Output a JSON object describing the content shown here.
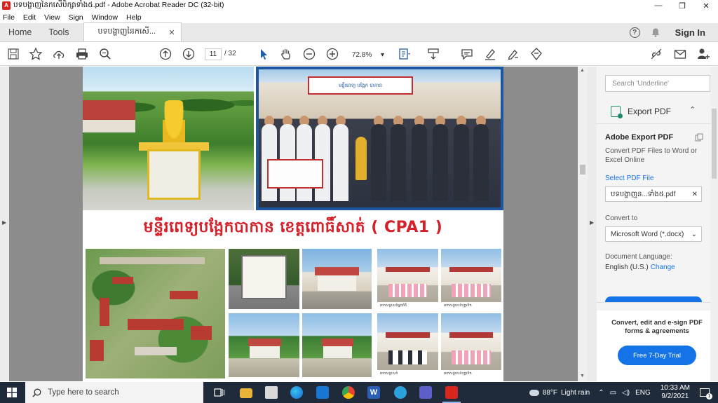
{
  "window": {
    "title": "បទបង្ហាញនៃកសើបិក្សាទាំង៥.pdf - Adobe Acrobat Reader DC (32-bit)",
    "minimize_glyph": "—",
    "maximize_glyph": "❐",
    "close_glyph": "✕"
  },
  "menu": [
    "File",
    "Edit",
    "View",
    "Sign",
    "Window",
    "Help"
  ],
  "tabs": {
    "home": "Home",
    "tools": "Tools",
    "document": "បទបង្ហាញនៃកសើ...",
    "close_glyph": "✕"
  },
  "header_right": {
    "help_glyph": "?",
    "sign_in": "Sign In"
  },
  "toolbar": {
    "current_page": "11",
    "total_pages": "/ 32",
    "zoom": "72.8%",
    "zoom_caret": "▾"
  },
  "document": {
    "heading": "មន្ទីរពេទ្យបង្អែកបាកាន ខេត្តពោធិ៍សាត់ ( CPA1 )",
    "captions": [
      "ឆាកសម្ភាសន៍អ្នកជំងឺ",
      "ឆាកសម្ភាសន៍បុគ្គលិក",
      "ឆាកសម្ភាសន៍",
      "ឆាកសម្ភាសន៍បុគ្គលិក"
    ],
    "sign_text": "មន្ទីរពេទ្យ បង្អែក បាកាន"
  },
  "right_pane": {
    "search_placeholder": "Search 'Underline'",
    "export_title": "Export PDF",
    "export_chevron": "⌃",
    "adobe_export_title": "Adobe Export PDF",
    "description": "Convert PDF Files to Word or Excel Online",
    "select_file": "Select PDF File",
    "file_name": "បទបង្ហាញន...ទាំង៥.pdf",
    "file_clear": "✕",
    "convert_to_label": "Convert to",
    "convert_to_value": "Microsoft Word (*.docx)",
    "select_caret": "⌄",
    "doc_language_label": "Document Language:",
    "doc_language_value": "English (U.S.)",
    "change_link": "Change",
    "promo_text": "Convert, edit and e-sign PDF forms & agreements",
    "trial_button": "Free 7-Day Trial"
  },
  "taskbar": {
    "search_placeholder": "Type here to search",
    "temperature": "88°F",
    "weather": "Light rain",
    "language": "ENG",
    "time": "10:33 AM",
    "date": "9/2/2021",
    "notification_count": "1"
  },
  "colors": {
    "accent": "#1473e6",
    "heading_red": "#d5202a",
    "taskbar": "#1f2b3a",
    "doc_background": "#8c8c8c"
  }
}
